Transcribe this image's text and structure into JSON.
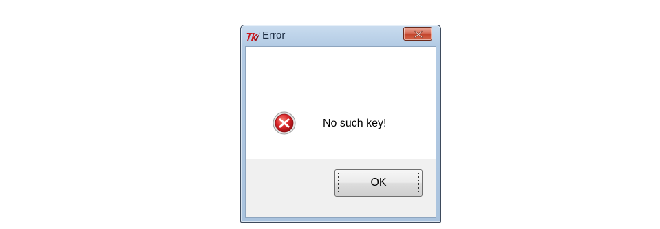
{
  "dialog": {
    "title": "Error",
    "message": "No such key!",
    "ok_label": "OK",
    "icons": {
      "app": "tk-feather-icon",
      "close": "close-icon",
      "error": "error-icon"
    }
  },
  "colors": {
    "titlebar": "#b3cbe4",
    "close_button": "#c3442c",
    "error_icon": "#c8151b",
    "footer": "#f0f0f0"
  }
}
